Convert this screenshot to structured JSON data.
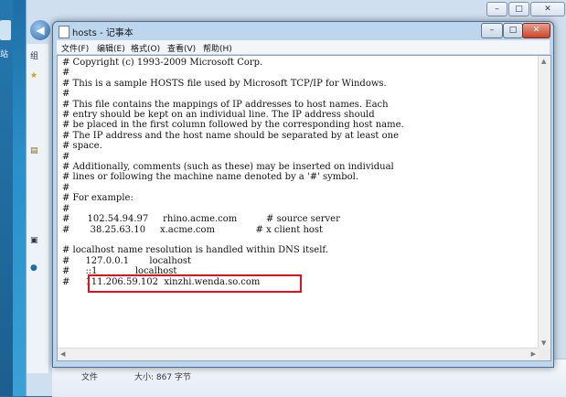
{
  "back_window": {
    "side_letters": [
      "组",
      "站"
    ],
    "details": {
      "type_label": "文件",
      "size_label": "大小: 867 字节"
    },
    "caption": {
      "min": "–",
      "max": "□",
      "close": "✕"
    }
  },
  "notepad": {
    "title": "hosts - 记事本",
    "caption": {
      "min": "–",
      "max": "□",
      "close": "✕"
    },
    "menu": [
      "文件(F)",
      "编辑(E)",
      "格式(O)",
      "查看(V)",
      "帮助(H)"
    ],
    "content": "# Copyright (c) 1993-2009 Microsoft Corp.\n#\n# This is a sample HOSTS file used by Microsoft TCP/IP for Windows.\n#\n# This file contains the mappings of IP addresses to host names. Each\n# entry should be kept on an individual line. The IP address should\n# be placed in the first column followed by the corresponding host name.\n# The IP address and the host name should be separated by at least one\n# space.\n#\n# Additionally, comments (such as these) may be inserted on individual\n# lines or following the machine name denoted by a '#' symbol.\n#\n# For example:\n#\n#      102.54.94.97     rhino.acme.com          # source server\n#       38.25.63.10     x.acme.com              # x client host\n\n# localhost name resolution is handled within DNS itself.\n#\t127.0.0.1       localhost\n#\t::1             localhost\n#\t111.206.59.102  xinzhi.wenda.so.com",
    "highlighted_entry": "111.206.59.102  xinzhi.wenda.so.com"
  },
  "colors": {
    "highlight_border": "#e0121a",
    "desktop": "#2a8fc9"
  }
}
